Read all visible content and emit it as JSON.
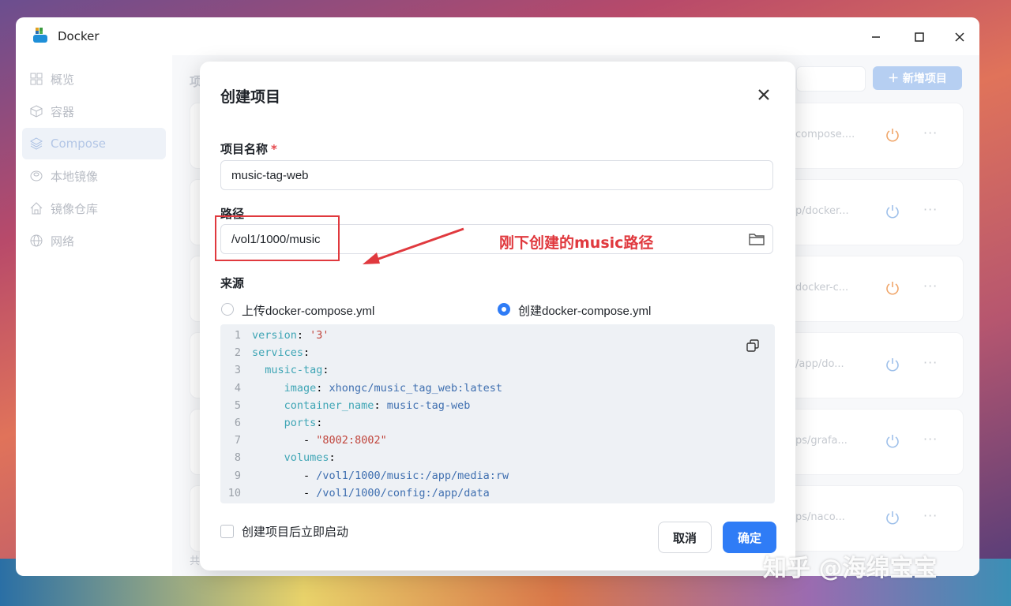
{
  "window": {
    "title": "Docker",
    "app_icon": "docker-whale-icon"
  },
  "sidebar": {
    "items": [
      {
        "label": "概览",
        "icon": "grid-icon"
      },
      {
        "label": "容器",
        "icon": "cube-icon"
      },
      {
        "label": "Compose",
        "icon": "layers-icon",
        "active": true
      },
      {
        "label": "本地镜像",
        "icon": "disk-icon"
      },
      {
        "label": "镜像仓库",
        "icon": "home-icon"
      },
      {
        "label": "网络",
        "icon": "globe-icon"
      }
    ]
  },
  "main": {
    "header_text": "项",
    "new_button": "＋  新增项目",
    "footer_text": "共",
    "cards": [
      {
        "path": "compose....",
        "power_color": "#f0a66a"
      },
      {
        "path": "p/docker...",
        "power_color": "#9ec0ea"
      },
      {
        "path": "docker-c...",
        "power_color": "#f0a66a"
      },
      {
        "path": "/app/do...",
        "power_color": "#9ec0ea"
      },
      {
        "path": "ps/grafa...",
        "power_color": "#9ec0ea"
      },
      {
        "path": "ps/naco...",
        "power_color": "#9ec0ea"
      }
    ]
  },
  "dialog": {
    "title": "创建项目",
    "name_label": "项目名称",
    "required_mark": "*",
    "name_value": "music-tag-web",
    "path_label": "路径",
    "path_value": "/vol1/1000/music",
    "source_label": "来源",
    "radio_upload": "上传docker-compose.yml",
    "radio_create": "创建docker-compose.yml",
    "code_lines": [
      {
        "n": "1",
        "parts": [
          [
            "k",
            "version"
          ],
          [
            "p",
            ": "
          ],
          [
            "s",
            "'3'"
          ]
        ],
        "indent": 0
      },
      {
        "n": "2",
        "parts": [
          [
            "k",
            "services"
          ],
          [
            "p",
            ":"
          ]
        ],
        "indent": 0
      },
      {
        "n": "3",
        "parts": [
          [
            "k",
            "music-tag"
          ],
          [
            "p",
            ":"
          ]
        ],
        "indent": 2
      },
      {
        "n": "4",
        "parts": [
          [
            "k",
            "image"
          ],
          [
            "p",
            ": "
          ],
          [
            "v",
            "xhongc/music_tag_web:latest"
          ]
        ],
        "indent": 5
      },
      {
        "n": "5",
        "parts": [
          [
            "k",
            "container_name"
          ],
          [
            "p",
            ": "
          ],
          [
            "v",
            "music-tag-web"
          ]
        ],
        "indent": 5
      },
      {
        "n": "6",
        "parts": [
          [
            "k",
            "ports"
          ],
          [
            "p",
            ":"
          ]
        ],
        "indent": 5
      },
      {
        "n": "7",
        "parts": [
          [
            "p",
            "- "
          ],
          [
            "s",
            "\"8002:8002\""
          ]
        ],
        "indent": 8
      },
      {
        "n": "8",
        "parts": [
          [
            "k",
            "volumes"
          ],
          [
            "p",
            ":"
          ]
        ],
        "indent": 5
      },
      {
        "n": "9",
        "parts": [
          [
            "p",
            "- "
          ],
          [
            "v",
            "/vol1/1000/music:/app/media:rw"
          ]
        ],
        "indent": 8
      },
      {
        "n": "10",
        "parts": [
          [
            "p",
            "- "
          ],
          [
            "v",
            "/vol1/1000/config:/app/data"
          ]
        ],
        "indent": 8
      }
    ],
    "autostart_label": "创建项目后立即启动",
    "cancel_label": "取消",
    "ok_label": "确定"
  },
  "annotation": {
    "text": "刚下创建的music路径",
    "color": "#e0393e"
  },
  "watermark": "知乎 @海绵宝宝",
  "colors": {
    "accent": "#2f7cf6",
    "required": "#e5484d"
  }
}
